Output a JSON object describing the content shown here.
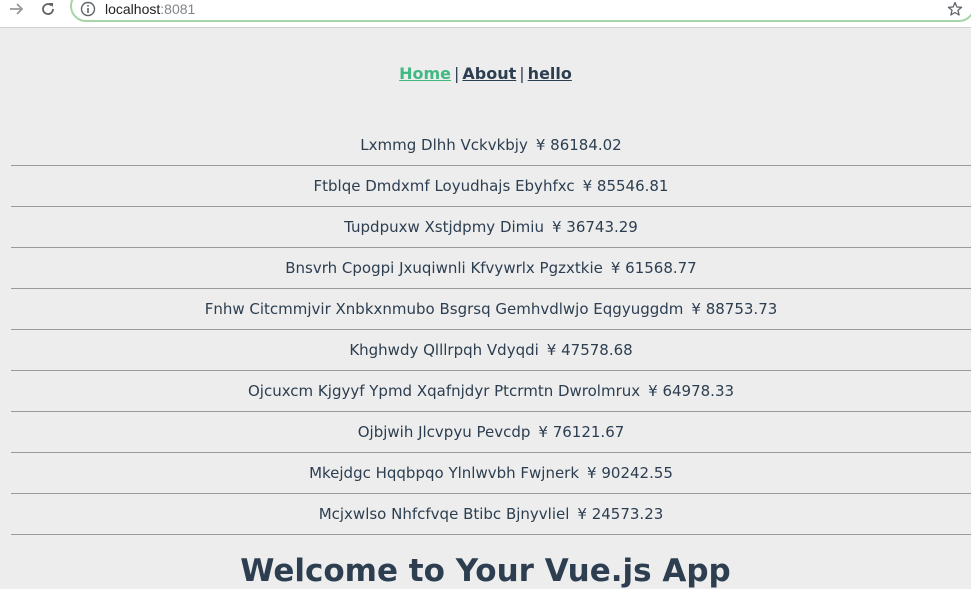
{
  "browser": {
    "url_host": "localhost",
    "url_port": ":8081",
    "icons": {
      "forward": "arrow-right-icon",
      "reload": "reload-icon",
      "info": "info-icon",
      "bookmark": "star-icon"
    }
  },
  "nav": {
    "links": [
      {
        "label": "Home",
        "active": true
      },
      {
        "label": "About",
        "active": false
      },
      {
        "label": "hello",
        "active": false
      }
    ],
    "separator": "|"
  },
  "products": [
    {
      "name": "Lxmmg Dlhh Vckvkbjy",
      "price": "¥ 86184.02"
    },
    {
      "name": "Ftblqe Dmdxmf Loyudhajs Ebyhfxc",
      "price": "¥ 85546.81"
    },
    {
      "name": "Tupdpuxw Xstjdpmy Dimiu",
      "price": "¥ 36743.29"
    },
    {
      "name": "Bnsvrh Cpogpi Jxuqiwnli Kfvywrlx Pgzxtkie",
      "price": "¥ 61568.77"
    },
    {
      "name": "Fnhw Citcmmjvir Xnbkxnmubo Bsgrsq Gemhvdlwjo Eqgyuggdm",
      "price": "¥ 88753.73"
    },
    {
      "name": "Khghwdy Qlllrpqh Vdyqdi",
      "price": "¥ 47578.68"
    },
    {
      "name": "Ojcuxcm Kjgyyf Ypmd Xqafnjdyr Ptcrmtn Dwrolmrux",
      "price": "¥ 64978.33"
    },
    {
      "name": "Ojbjwih Jlcvpyu Pevcdp",
      "price": "¥ 76121.67"
    },
    {
      "name": "Mkejdgc Hqqbpqo Ylnlwvbh Fwjnerk",
      "price": "¥ 90242.55"
    },
    {
      "name": "Mcjxwlso Nhfcfvqe Btibc Bjnyvliel",
      "price": "¥ 24573.23"
    }
  ],
  "welcome_heading": "Welcome to Your Vue.js App",
  "colors": {
    "active_link": "#42b983",
    "text": "#2c3e50",
    "background": "#ededed",
    "row_border": "#9a9a9a"
  }
}
